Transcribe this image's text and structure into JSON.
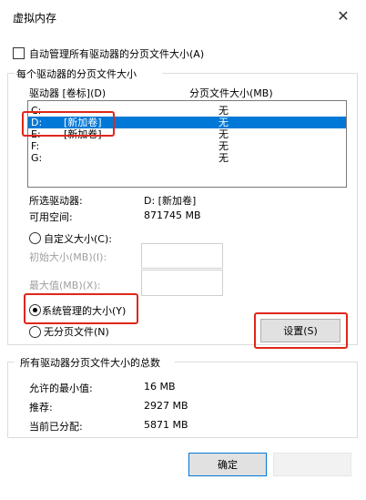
{
  "window": {
    "title": "虚拟内存",
    "close_glyph": "✕"
  },
  "auto_manage": {
    "label": "自动管理所有驱动器的分页文件大小(A)",
    "checked": false
  },
  "group1": {
    "title": "每个驱动器的分页文件大小",
    "col_drive": "驱动器 [卷标](D)",
    "col_pagesize": "分页文件大小(MB)",
    "rows": [
      {
        "drive": "C:",
        "volume": "",
        "size": "无",
        "selected": false
      },
      {
        "drive": "D:",
        "volume": "[新加卷]",
        "size": "无",
        "selected": true
      },
      {
        "drive": "E:",
        "volume": "[新加卷]",
        "size": "无",
        "selected": false
      },
      {
        "drive": "F:",
        "volume": "",
        "size": "无",
        "selected": false
      },
      {
        "drive": "G:",
        "volume": "",
        "size": "无",
        "selected": false
      }
    ],
    "selected_drive_label": "所选驱动器:",
    "selected_drive_value": "D: [新加卷]",
    "free_space_label": "可用空间:",
    "free_space_value": "871745 MB",
    "custom_size_label": "自定义大小(C):",
    "initial_size_label": "初始大小(MB)(I):",
    "max_size_label": "最大值(MB)(X):",
    "system_managed_label": "系统管理的大小(Y)",
    "no_paging_label": "无分页文件(N)",
    "set_button": "设置(S)"
  },
  "group2": {
    "title": "所有驱动器分页文件大小的总数",
    "min_label": "允许的最小值:",
    "min_value": "16 MB",
    "recommended_label": "推荐:",
    "recommended_value": "2927 MB",
    "current_label": "当前已分配:",
    "current_value": "5871 MB"
  },
  "footer": {
    "ok_button": "确定"
  },
  "colors": {
    "selection": "#0078d7",
    "highlight_box": "#e0261b"
  }
}
